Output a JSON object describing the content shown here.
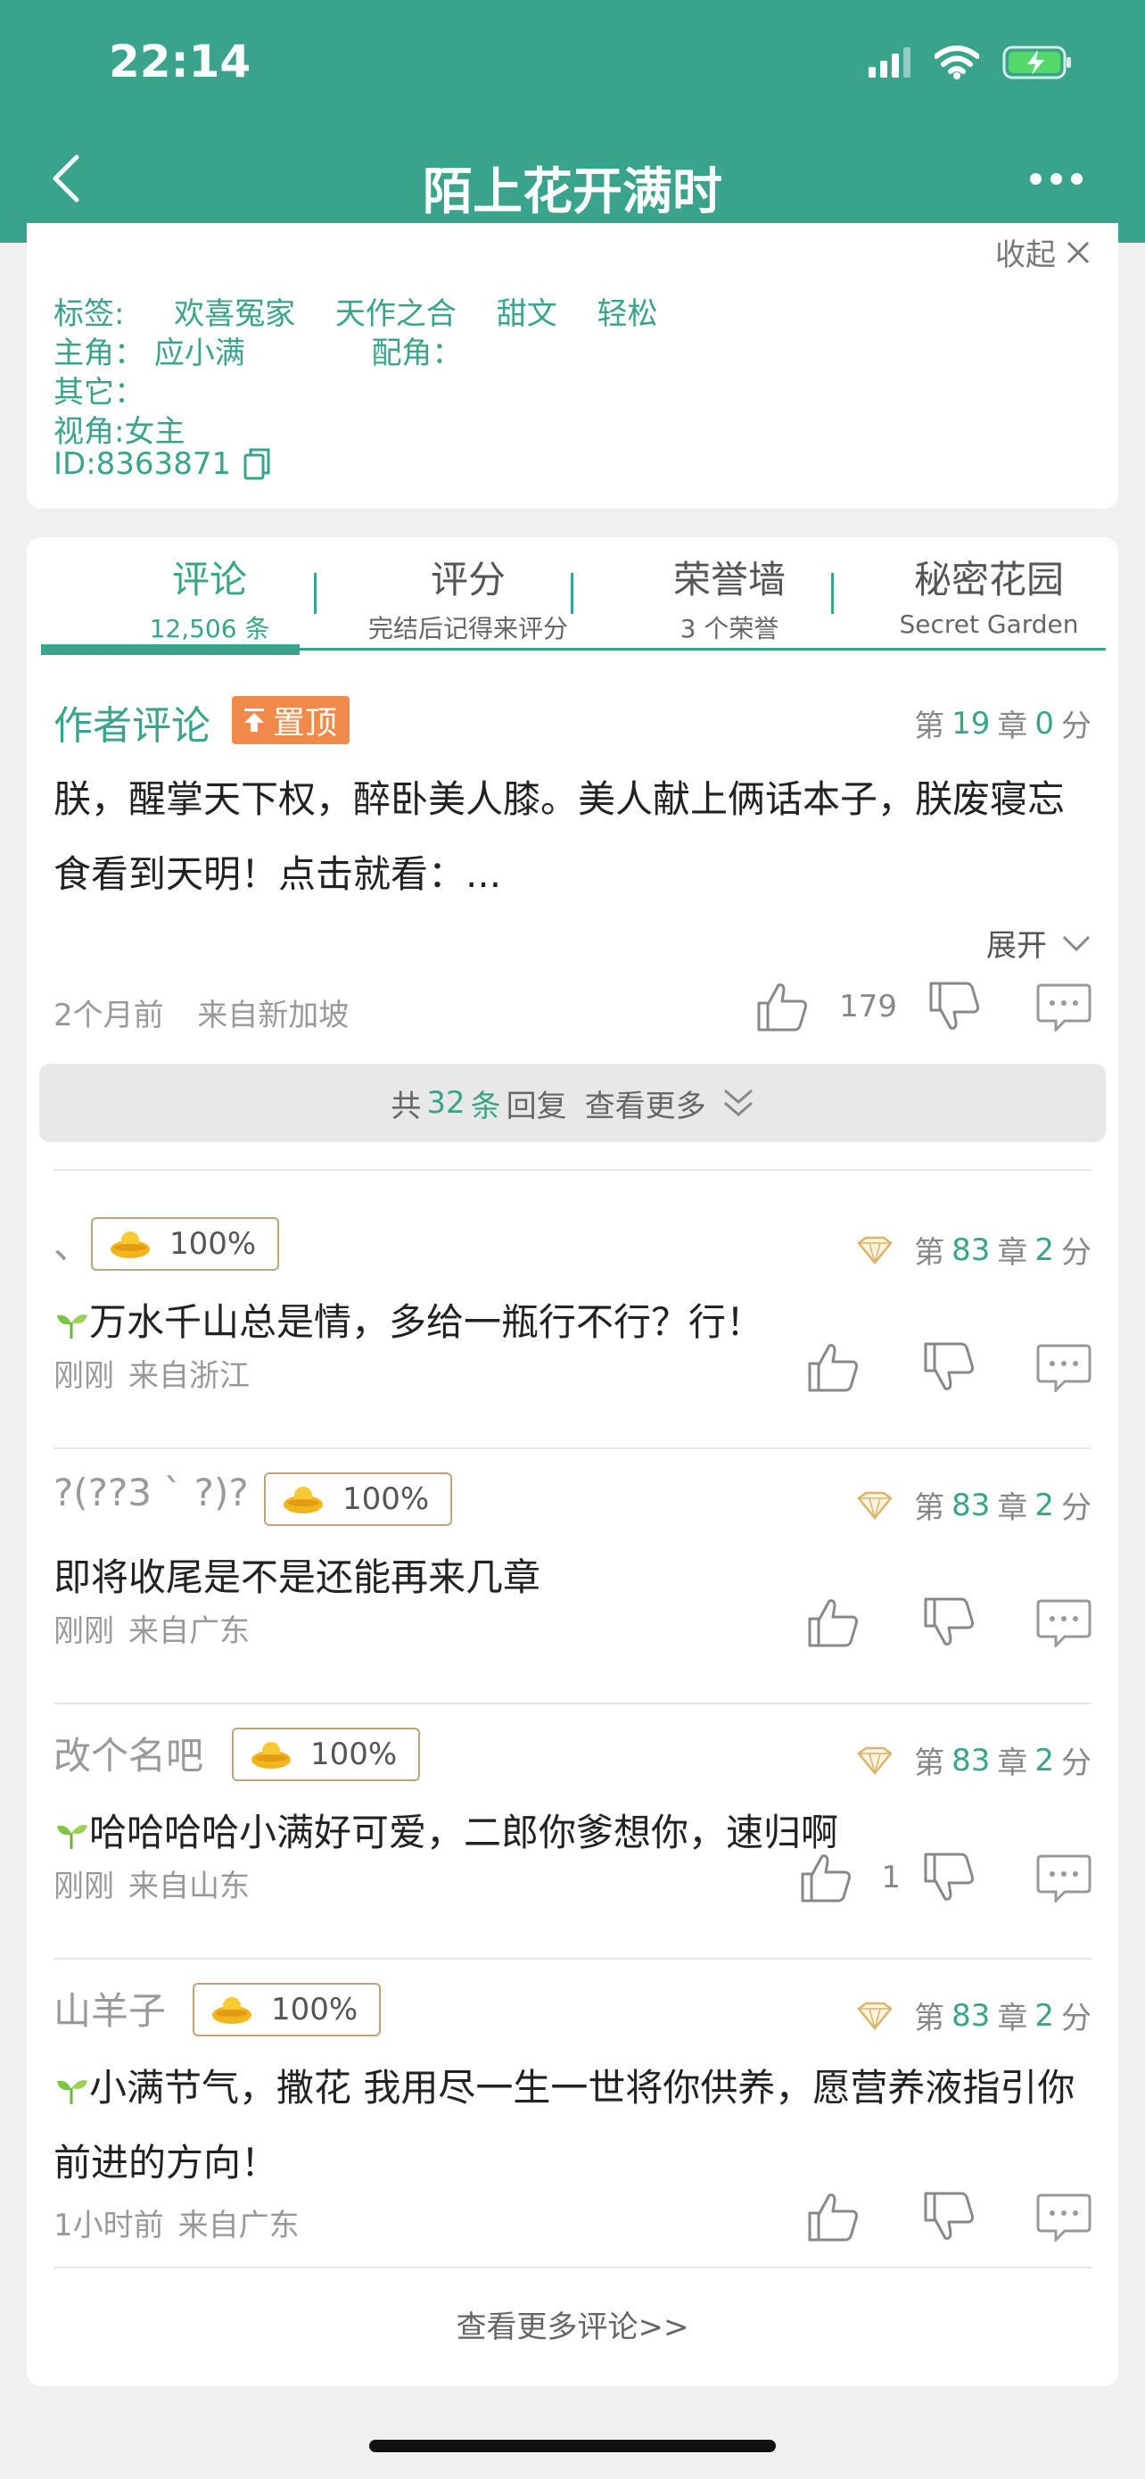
{
  "status_bar": {
    "time": "22:14"
  },
  "nav": {
    "title": "陌上花开满时"
  },
  "info": {
    "collapse_label": "收起",
    "tags_label": "标签:",
    "tags": [
      "欢喜冤家",
      "天作之合",
      "甜文",
      "轻松"
    ],
    "lead_label": "主角：",
    "lead_value": "应小满",
    "support_label": "配角：",
    "other_label": "其它：",
    "pov": "视角:女主",
    "id": "ID:8363871"
  },
  "tabs": [
    {
      "label": "评论",
      "sub": "12,506 条"
    },
    {
      "label": "评分",
      "sub": "完结后记得来评分"
    },
    {
      "label": "荣誉墙",
      "sub": "3 个荣誉"
    },
    {
      "label": "秘密花园",
      "sub": "Secret Garden"
    }
  ],
  "author_comment": {
    "title": "作者评论",
    "pin_label": "置顶",
    "chapter_prefix": "第",
    "chapter": "19",
    "chapter_suffix": "章",
    "score": "0",
    "score_suffix": "分",
    "body": "朕，醒掌天下权，醉卧美人膝。美人献上俩话本子，朕废寝忘食看到天明！点击就看：...",
    "expand_label": "展开",
    "time": "2个月前",
    "location": "来自新加坡",
    "likes": "179"
  },
  "replies_bar": {
    "prefix": "共",
    "count": "32",
    "suffix": "条",
    "mid": "回复",
    "more": "查看更多"
  },
  "comments": [
    {
      "user": "、",
      "badge": "100%",
      "chapter": "83",
      "score": "2",
      "text": "万水千山总是情，多给一瓶行不行？行！",
      "sprout": true,
      "time": "刚刚",
      "location": "来自浙江",
      "likes": ""
    },
    {
      "user": "?(??3 ` ?)?",
      "badge": "100%",
      "chapter": "83",
      "score": "2",
      "text": "即将收尾是不是还能再来几章",
      "sprout": false,
      "time": "刚刚",
      "location": "来自广东",
      "likes": ""
    },
    {
      "user": "改个名吧",
      "badge": "100%",
      "chapter": "83",
      "score": "2",
      "text": "哈哈哈哈小满好可爱，二郎你爹想你，速归啊",
      "sprout": true,
      "time": "刚刚",
      "location": "来自山东",
      "likes": "1"
    },
    {
      "user": "山羊子",
      "badge": "100%",
      "chapter": "83",
      "score": "2",
      "text": "小满节气，撒花 我用尽一生一世将你供养，愿营养液指引你前进的方向！",
      "sprout": true,
      "time": "1小时前",
      "location": "来自广东",
      "likes": ""
    }
  ],
  "comment_meta": {
    "chapter_prefix": "第",
    "chapter_suffix": "章",
    "score_suffix": "分"
  },
  "view_more": "查看更多评论>>",
  "colors": {
    "brand": "#3aa38c",
    "pin": "#f08a4b",
    "badge_border": "#bfa37a"
  }
}
